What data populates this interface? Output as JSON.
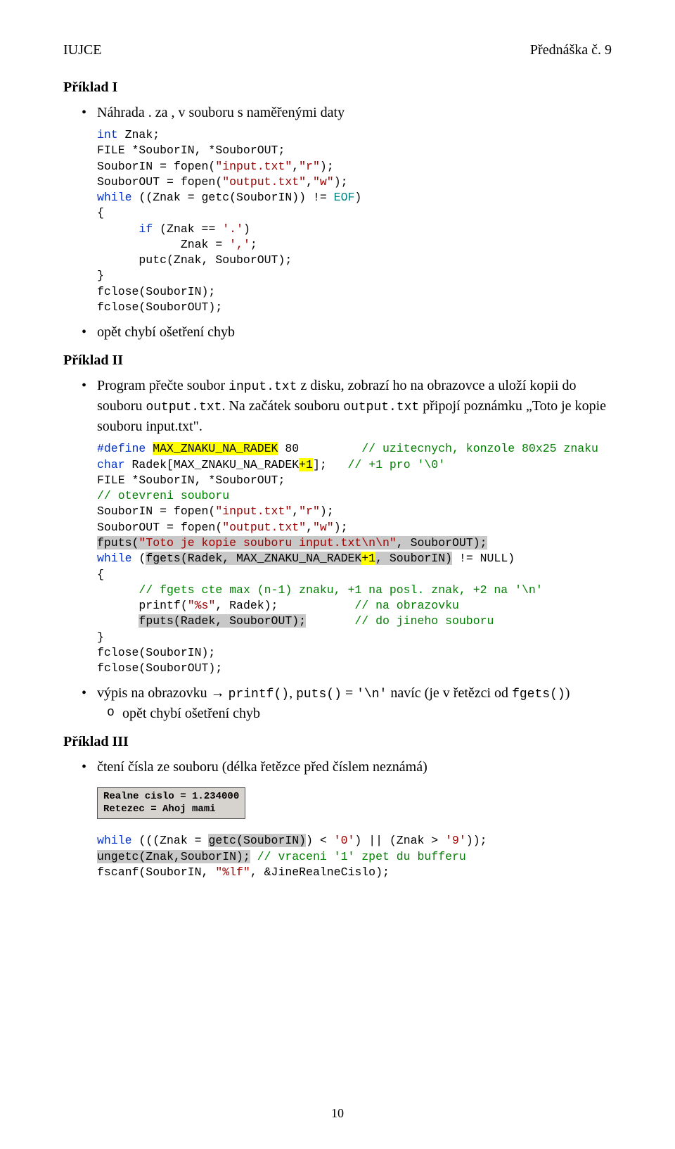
{
  "header": {
    "left": "IUJCE",
    "right": "Přednáška č. 9"
  },
  "priklad1": {
    "title": "Příklad I",
    "bullet1": "Náhrada . za , v souboru s naměřenými daty",
    "code": "int Znak;\nFILE *SouborIN, *SouborOUT;\nSouborIN = fopen(\"input.txt\",\"r\");\nSouborOUT = fopen(\"output.txt\",\"w\");\nwhile ((Znak = getc(SouborIN)) != EOF)\n{\n      if (Znak == '.')\n            Znak = ',';\n      putc(Znak, SouborOUT);\n}\nfclose(SouborIN);\nfclose(SouborOUT);",
    "bullet2": "opět chybí ošetření chyb"
  },
  "priklad2": {
    "title": "Příklad II",
    "bullet1_pre": "Program přečte soubor ",
    "bullet1_code1": "input.txt",
    "bullet1_mid": " z disku, zobrazí ho na obrazovce a uloží kopii do souboru ",
    "bullet1_code2": "output.txt",
    "bullet1_mid2": ". Na začátek souboru ",
    "bullet1_code3": "output.txt",
    "bullet1_post": " připojí poznámku „Toto je kopie souboru input.txt\".",
    "bullet2_pre": "výpis na obrazovku → ",
    "bullet2_code1": "printf()",
    "bullet2_mid": ", ",
    "bullet2_code2": "puts()",
    "bullet2_mid2": " = ",
    "bullet2_code3": "'\\n'",
    "bullet2_mid3": " navíc (je v řetězci od ",
    "bullet2_code4": "fgets()",
    "bullet2_post": ")",
    "sub_bullet": "opět chybí ošetření chyb"
  },
  "priklad3": {
    "title": "Příklad III",
    "bullet1": "čtení čísla ze  souboru (délka řetězce před číslem neznámá)",
    "screenshot_line1": "Realne cislo = 1.234000",
    "screenshot_line2": "Retezec = Ahoj mami"
  },
  "page_number": "10",
  "chart_data": null
}
